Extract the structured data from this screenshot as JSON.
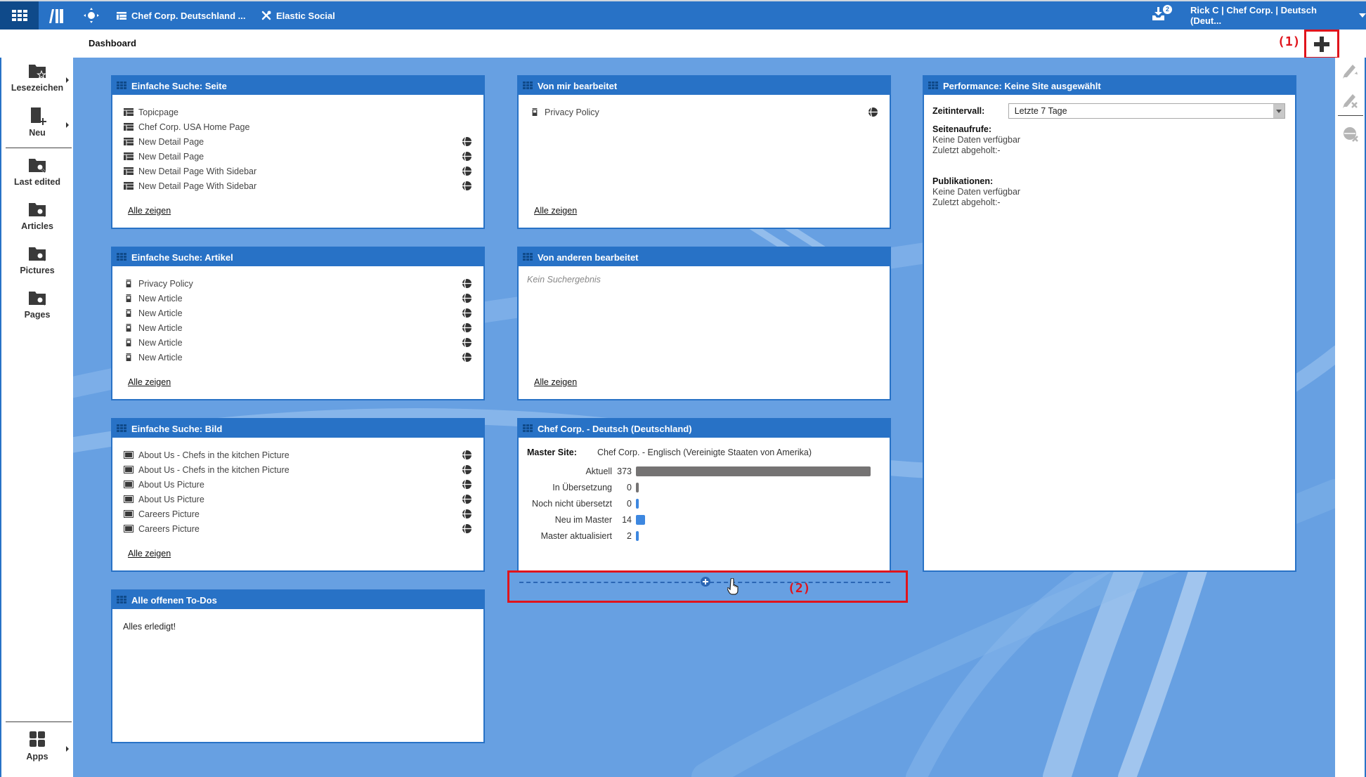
{
  "topbar": {
    "apps_menu": "apps-grid-icon",
    "library": "library-icon",
    "preferences": "compass-icon",
    "site_selector": "Chef Corp. Deutschland ...",
    "elastic_social": "Elastic Social",
    "notifications_count": "2",
    "user_menu": "Rick C | Chef Corp. | Deutsch (Deut..."
  },
  "subheader": {
    "title": "Dashboard",
    "annotation_1": "(1)"
  },
  "sidebar": {
    "items": [
      {
        "label": "Lesezeichen",
        "icon": "bookmark-folder-icon",
        "has_submenu": true
      },
      {
        "label": "Neu",
        "icon": "new-document-icon",
        "has_submenu": true
      },
      {
        "label": "Last edited",
        "icon": "search-folder-icon"
      },
      {
        "label": "Articles",
        "icon": "search-folder-icon"
      },
      {
        "label": "Pictures",
        "icon": "search-folder-icon"
      },
      {
        "label": "Pages",
        "icon": "search-folder-icon"
      }
    ],
    "apps_label": "Apps"
  },
  "right_toolbar": {
    "items": [
      "withdraw-icon",
      "delete-edit-icon",
      "unpublish-icon"
    ]
  },
  "widgets": {
    "pages": {
      "title": "Einfache Suche: Seite",
      "items": [
        {
          "label": "Topicpage",
          "published": false
        },
        {
          "label": "Chef Corp. USA Home Page",
          "published": false
        },
        {
          "label": "New Detail Page",
          "published": true
        },
        {
          "label": "New Detail Page",
          "published": true
        },
        {
          "label": "New Detail Page With Sidebar",
          "published": true
        },
        {
          "label": "New Detail Page With Sidebar",
          "published": true
        }
      ],
      "show_all": "Alle zeigen"
    },
    "articles": {
      "title": "Einfache Suche: Artikel",
      "items": [
        {
          "label": "Privacy Policy",
          "published": true
        },
        {
          "label": "New Article",
          "published": true
        },
        {
          "label": "New Article",
          "published": true
        },
        {
          "label": "New Article",
          "published": true
        },
        {
          "label": "New Article",
          "published": true
        },
        {
          "label": "New Article",
          "published": true
        }
      ],
      "show_all": "Alle zeigen"
    },
    "pictures": {
      "title": "Einfache Suche: Bild",
      "items": [
        {
          "label": "About Us - Chefs in the kitchen Picture",
          "published": true
        },
        {
          "label": "About Us - Chefs in the kitchen Picture",
          "published": true
        },
        {
          "label": "About Us Picture",
          "published": true
        },
        {
          "label": "About Us Picture",
          "published": true
        },
        {
          "label": "Careers Picture",
          "published": true
        },
        {
          "label": "Careers Picture",
          "published": true
        }
      ],
      "show_all": "Alle zeigen"
    },
    "todos": {
      "title": "Alle offenen To-Dos",
      "message": "Alles erledigt!"
    },
    "edited_by_me": {
      "title": "Von mir bearbeitet",
      "items": [
        {
          "label": "Privacy Policy",
          "published": true
        }
      ],
      "show_all": "Alle zeigen"
    },
    "edited_by_others": {
      "title": "Von anderen bearbeitet",
      "empty": "Kein Suchergebnis",
      "show_all": "Alle zeigen"
    },
    "translation": {
      "title": "Chef Corp. - Deutsch (Deutschland)",
      "master_label": "Master Site:",
      "master_value": "Chef Corp. - Englisch (Vereinigte Staaten von Amerika)",
      "max": 373,
      "rows": [
        {
          "label": "Aktuell",
          "value": 373,
          "color": "#757373"
        },
        {
          "label": "In Übersetzung",
          "value": 0,
          "color": "#757373"
        },
        {
          "label": "Noch nicht übersetzt",
          "value": 0,
          "color": "#3d87e0"
        },
        {
          "label": "Neu im Master",
          "value": 14,
          "color": "#3d87e0"
        },
        {
          "label": "Master aktualisiert",
          "value": 2,
          "color": "#3d87e0"
        }
      ]
    },
    "performance": {
      "title": "Performance: Keine Site ausgewählt",
      "interval_label": "Zeitintervall:",
      "interval_value": "Letzte 7 Tage",
      "page_views_label": "Seitenaufrufe:",
      "page_views_status": "Keine Daten verfügbar",
      "page_views_fetched": "Zuletzt abgeholt:-",
      "publications_label": "Publikationen:",
      "publications_status": "Keine Daten verfügbar",
      "publications_fetched": "Zuletzt abgeholt:-"
    }
  },
  "dropzone": {
    "annotation_2": "(2)"
  },
  "colors": {
    "brand_blue": "#2872c6",
    "dark_blue": "#0f4a8a",
    "workspace_blue": "#67a0e2",
    "annotation_red": "#e0141c"
  }
}
